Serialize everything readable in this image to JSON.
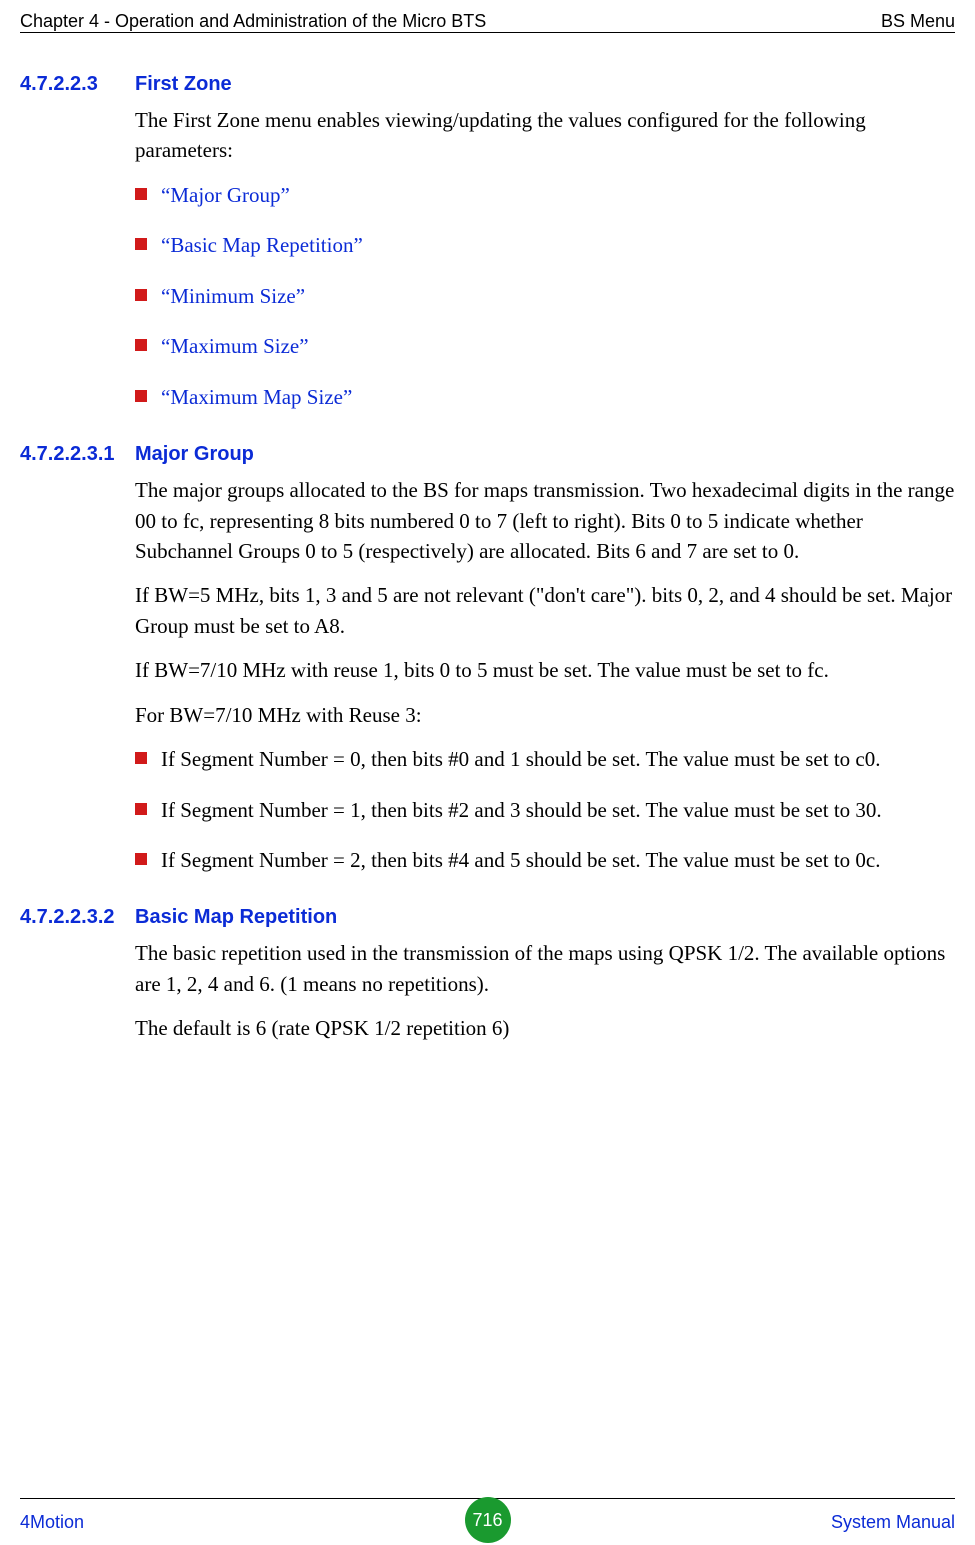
{
  "header": {
    "left": "Chapter 4 - Operation and Administration of the Micro BTS",
    "right": "BS Menu"
  },
  "footer": {
    "left": "4Motion",
    "page": "716",
    "right": "System Manual"
  },
  "s1": {
    "num": "4.7.2.2.3",
    "title": "First Zone",
    "intro": "The First Zone menu enables viewing/updating the values configured for the following parameters:",
    "bullets": [
      "“Major Group”",
      "“Basic Map Repetition”",
      "“Minimum Size”",
      "“Maximum Size”",
      "“Maximum Map Size”"
    ]
  },
  "s2": {
    "num": "4.7.2.2.3.1",
    "title": "Major Group",
    "p1": "The major groups allocated to the BS for maps transmission. Two hexadecimal digits in the range 00 to fc, representing 8 bits numbered 0 to 7 (left to right). Bits 0 to 5 indicate whether Subchannel Groups 0 to 5 (respectively) are allocated. Bits 6 and 7 are set to 0.",
    "p2": "If BW=5 MHz, bits 1, 3 and 5 are not relevant (\"don't care\"). bits 0, 2, and 4 should be set. Major Group must be set to A8.",
    "p3": "If BW=7/10 MHz with reuse 1, bits 0 to 5 must be set. The value must be set to fc.",
    "p4": "For BW=7/10 MHz with Reuse 3:",
    "bullets": [
      "If Segment Number = 0, then bits #0 and 1 should be set. The value must be set to c0.",
      "If Segment Number = 1, then bits #2 and 3 should be set. The value must be set to 30.",
      "If Segment Number = 2, then bits #4 and 5 should be set. The value must be set to 0c."
    ]
  },
  "s3": {
    "num": "4.7.2.2.3.2",
    "title": "Basic Map Repetition",
    "p1": "The basic repetition used in the transmission of the maps using QPSK 1/2. The available options are 1, 2, 4 and 6. (1 means no repetitions).",
    "p2": "The default is 6 (rate QPSK 1/2 repetition 6)"
  }
}
